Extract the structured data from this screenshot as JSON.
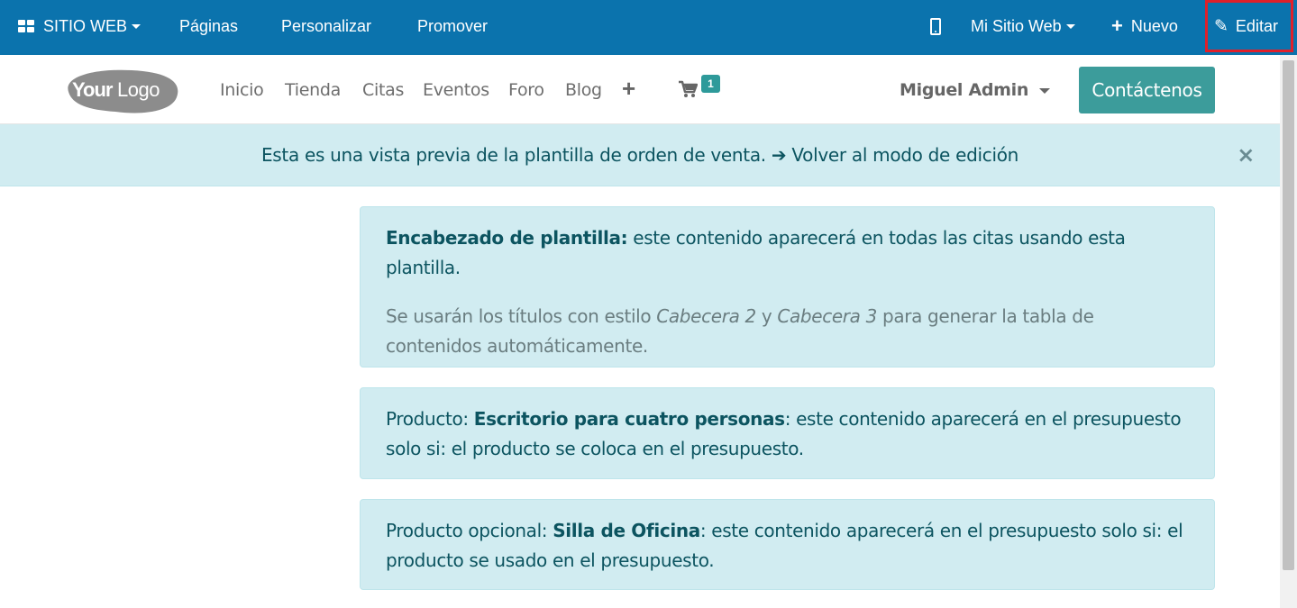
{
  "topbar": {
    "website_label": "SITIO WEB",
    "pages_label": "Páginas",
    "customize_label": "Personalizar",
    "promote_label": "Promover",
    "mysite_label": "Mi Sitio Web",
    "new_label": "Nuevo",
    "edit_label": "Editar",
    "highlight_color": "#e0202a",
    "background_color": "#0b73ad"
  },
  "navbar": {
    "logo_text_bold": "Your",
    "logo_text_light": "Logo",
    "links": [
      "Inicio",
      "Tienda",
      "Citas",
      "Eventos",
      "Foro",
      "Blog"
    ],
    "cart_count": "1",
    "user_name": "Miguel Admin",
    "contact_label": "Contáctenos",
    "accent_color": "#3c9c9b"
  },
  "preview": {
    "message": "Esta es una vista previa de la plantilla de orden de venta.",
    "back_label": "Volver al modo de edición",
    "close_symbol": "×"
  },
  "cards": {
    "header": {
      "title": "Encabezado de plantilla:",
      "text": " este contenido aparecerá en todas las citas usando esta plantilla.",
      "note_prefix": "Se usarán los títulos con estilo ",
      "note_style1": "Cabecera 2",
      "note_mid": " y ",
      "note_style2": "Cabecera 3",
      "note_suffix": " para generar la tabla de contenidos automáticamente."
    },
    "product": {
      "prefix": "Producto: ",
      "name": "Escritorio para cuatro personas",
      "text": ": este contenido aparecerá en el presupuesto solo si: el producto se coloca en el presupuesto."
    },
    "optional": {
      "prefix": "Producto opcional: ",
      "name": "Silla de Oficina",
      "text": ": este contenido aparecerá en el presupuesto solo si: el producto se usado en el presupuesto."
    }
  }
}
